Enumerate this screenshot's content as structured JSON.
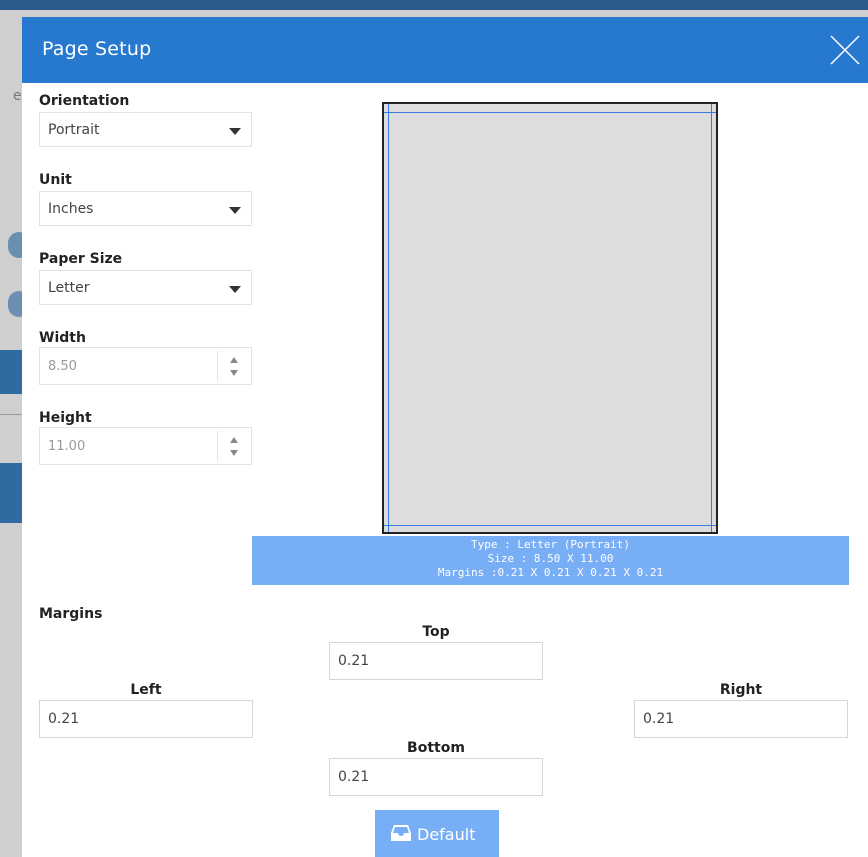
{
  "dialog": {
    "title": "Page Setup"
  },
  "background": {
    "partial_char": "e"
  },
  "form": {
    "orientation": {
      "label": "Orientation",
      "value": "Portrait"
    },
    "unit": {
      "label": "Unit",
      "value": "Inches"
    },
    "paper_size": {
      "label": "Paper Size",
      "value": "Letter"
    },
    "width": {
      "label": "Width",
      "value": "8.50"
    },
    "height": {
      "label": "Height",
      "value": "11.00"
    }
  },
  "preview": {
    "line1": "Type : Letter (Portrait)",
    "line2": "Size : 8.50 X 11.00",
    "line3": "Margins :0.21 X 0.21 X 0.21 X 0.21"
  },
  "margins": {
    "heading": "Margins",
    "top": {
      "label": "Top",
      "value": "0.21"
    },
    "left": {
      "label": "Left",
      "value": "0.21"
    },
    "right": {
      "label": "Right",
      "value": "0.21"
    },
    "bottom": {
      "label": "Bottom",
      "value": "0.21"
    }
  },
  "actions": {
    "default_label": "Default"
  },
  "icons": {
    "close": "close-icon",
    "inbox": "inbox-icon",
    "dropdown": "chevron-down-icon",
    "spinner_up": "caret-up-icon",
    "spinner_down": "caret-down-icon"
  },
  "colors": {
    "header": "#2778cf",
    "banner": "#78aef5",
    "button": "#78aef5",
    "preview_fill": "#dddddd",
    "margin_guides": "#3a7de0"
  }
}
